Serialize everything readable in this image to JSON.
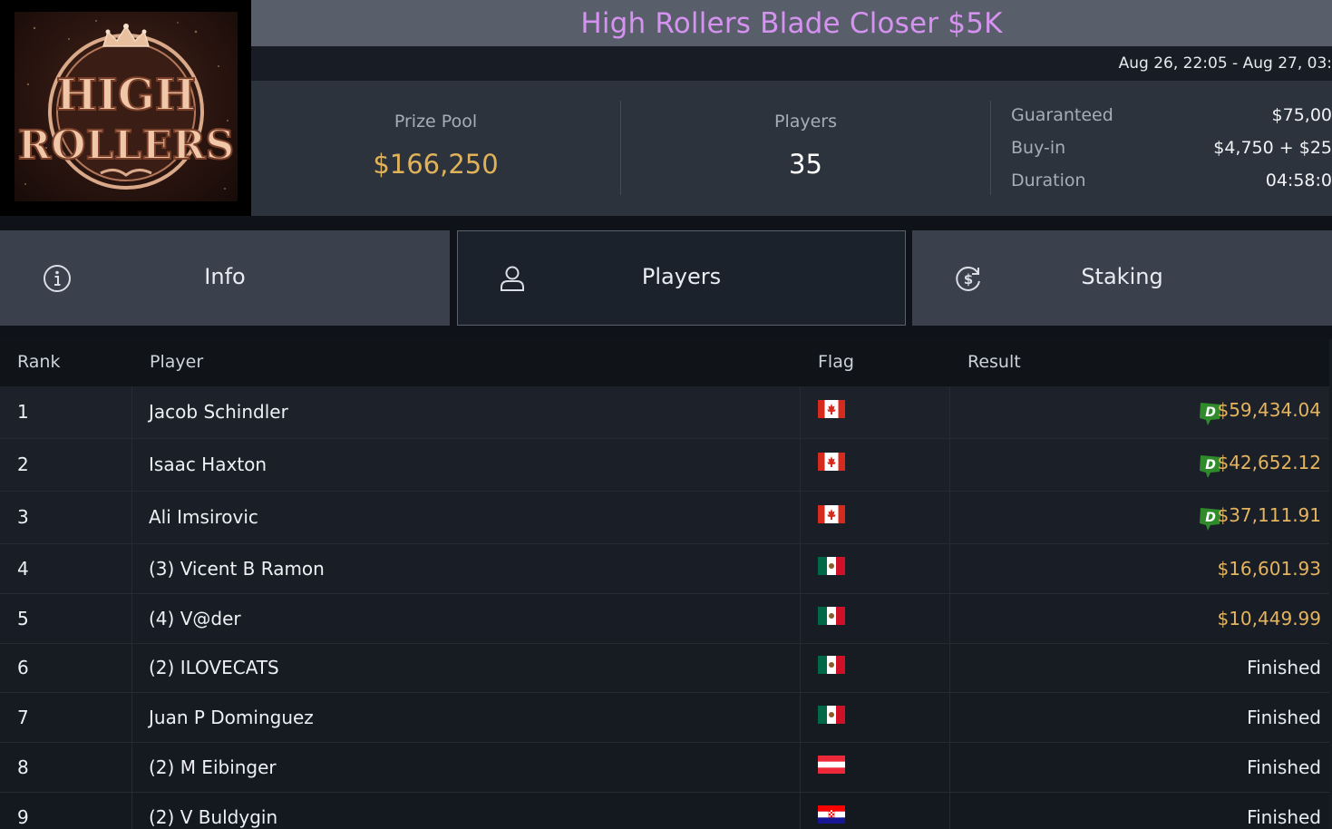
{
  "logo": {
    "line1": "HIGH",
    "line2": "ROLLERS"
  },
  "tournament": {
    "title": "High Rollers Blade Closer $5K",
    "dates": "Aug 26, 22:05 - Aug 27, 03:"
  },
  "stats": {
    "prize_pool_label": "Prize Pool",
    "prize_pool_value": "$166,250",
    "players_label": "Players",
    "players_value": "35",
    "details": [
      {
        "label": "Guaranteed",
        "value": "$75,00"
      },
      {
        "label": "Buy-in",
        "value": "$4,750 + $25"
      },
      {
        "label": "Duration",
        "value": "04:58:0"
      }
    ]
  },
  "tabs": [
    {
      "label": "Info",
      "icon": "info-icon",
      "selected": false
    },
    {
      "label": "Players",
      "icon": "user-icon",
      "selected": true
    },
    {
      "label": "Staking",
      "icon": "dollar-cycle-icon",
      "selected": false
    }
  ],
  "table": {
    "headers": {
      "rank": "Rank",
      "player": "Player",
      "flag": "Flag",
      "result": "Result"
    },
    "badge_letter": "D",
    "rows": [
      {
        "rank": "1",
        "player": "Jacob Schindler",
        "flag": "canada",
        "result": "$59,434.04",
        "badge": true
      },
      {
        "rank": "2",
        "player": "Isaac Haxton",
        "flag": "canada",
        "result": "$42,652.12",
        "badge": true
      },
      {
        "rank": "3",
        "player": "Ali Imsirovic",
        "flag": "canada",
        "result": "$37,111.91",
        "badge": true
      },
      {
        "rank": "4",
        "player": "(3) Vicent B Ramon",
        "flag": "mexico",
        "result": "$16,601.93",
        "badge": false
      },
      {
        "rank": "5",
        "player": "(4) V@der",
        "flag": "mexico",
        "result": "$10,449.99",
        "badge": false
      },
      {
        "rank": "6",
        "player": "(2) ILOVECATS",
        "flag": "mexico",
        "result": "Finished",
        "badge": false
      },
      {
        "rank": "7",
        "player": "Juan P Dominguez",
        "flag": "mexico",
        "result": "Finished",
        "badge": false
      },
      {
        "rank": "8",
        "player": "(2) M Eibinger",
        "flag": "austria",
        "result": "Finished",
        "badge": false
      },
      {
        "rank": "9",
        "player": "(2) V Buldygin",
        "flag": "croatia",
        "result": "Finished",
        "badge": false
      }
    ]
  },
  "colors": {
    "title": "#d692f0",
    "money": "#e4b45e",
    "badge_green": "#2f8a2c"
  }
}
